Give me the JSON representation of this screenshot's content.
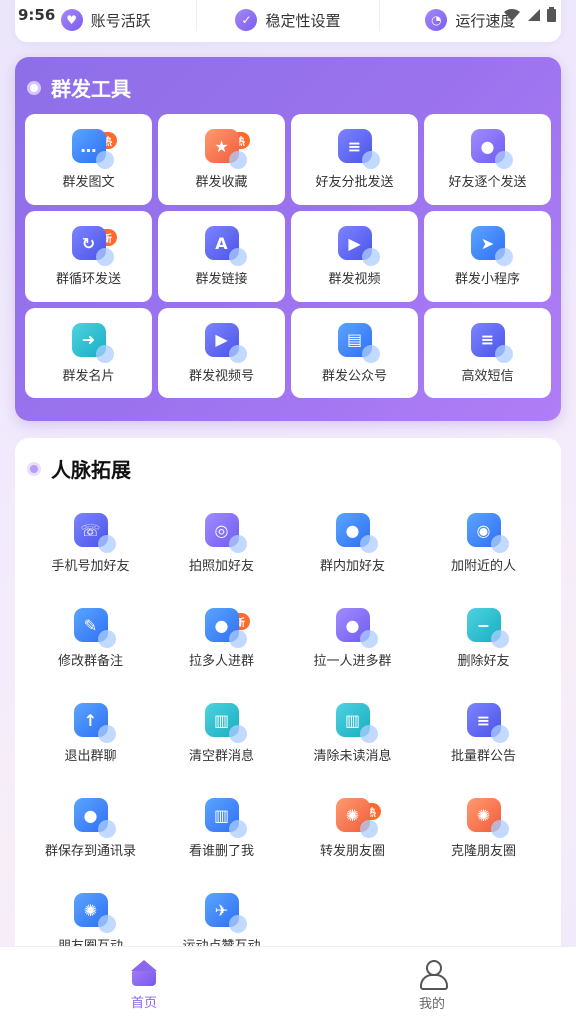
{
  "status_bar": {
    "time": "9:56"
  },
  "top_strip": {
    "items": [
      {
        "label": "账号活跃",
        "icon": "account-activity-icon"
      },
      {
        "label": "稳定性设置",
        "icon": "shield-check-icon"
      },
      {
        "label": "运行速度",
        "icon": "speedometer-icon"
      }
    ]
  },
  "tools": {
    "title": "群发工具",
    "items": [
      {
        "label": "群发图文",
        "badge": "热",
        "icon": "chat-bubble-icon"
      },
      {
        "label": "群发收藏",
        "badge": "热",
        "icon": "star-folder-icon"
      },
      {
        "label": "好友分批发送",
        "badge": "",
        "icon": "batch-list-icon"
      },
      {
        "label": "好友逐个发送",
        "badge": "",
        "icon": "contacts-icon"
      },
      {
        "label": "群循环发送",
        "badge": "新",
        "icon": "loop-send-icon"
      },
      {
        "label": "群发链接",
        "badge": "",
        "icon": "link-icon"
      },
      {
        "label": "群发视频",
        "badge": "",
        "icon": "video-icon"
      },
      {
        "label": "群发小程序",
        "badge": "",
        "icon": "paper-plane-icon"
      },
      {
        "label": "群发名片",
        "badge": "",
        "icon": "card-icon"
      },
      {
        "label": "群发视频号",
        "badge": "",
        "icon": "tv-icon"
      },
      {
        "label": "群发公众号",
        "badge": "",
        "icon": "official-account-icon"
      },
      {
        "label": "高效短信",
        "badge": "",
        "icon": "sms-icon"
      }
    ]
  },
  "network": {
    "title": "人脉拓展",
    "items": [
      {
        "label": "手机号加好友",
        "badge": "",
        "icon": "phone-add-icon"
      },
      {
        "label": "拍照加好友",
        "badge": "",
        "icon": "camera-add-icon"
      },
      {
        "label": "群内加好友",
        "badge": "",
        "icon": "group-add-icon"
      },
      {
        "label": "加附近的人",
        "badge": "",
        "icon": "location-add-icon"
      },
      {
        "label": "修改群备注",
        "badge": "",
        "icon": "edit-note-icon"
      },
      {
        "label": "拉多人进群",
        "badge": "新",
        "icon": "multi-invite-icon"
      },
      {
        "label": "拉一人进多群",
        "badge": "",
        "icon": "single-invite-icon"
      },
      {
        "label": "删除好友",
        "badge": "",
        "icon": "trash-icon"
      },
      {
        "label": "退出群聊",
        "badge": "",
        "icon": "exit-group-icon"
      },
      {
        "label": "清空群消息",
        "badge": "",
        "icon": "clear-bin-icon"
      },
      {
        "label": "清除未读消息",
        "badge": "",
        "icon": "clear-unread-icon"
      },
      {
        "label": "批量群公告",
        "badge": "",
        "icon": "announcement-icon"
      },
      {
        "label": "群保存到通讯录",
        "badge": "",
        "icon": "save-contacts-icon"
      },
      {
        "label": "看谁删了我",
        "badge": "",
        "icon": "detect-deleted-icon"
      },
      {
        "label": "转发朋友圈",
        "badge": "热",
        "icon": "moments-forward-icon"
      },
      {
        "label": "克隆朋友圈",
        "badge": "",
        "icon": "moments-clone-icon"
      },
      {
        "label": "朋友圈互动",
        "badge": "",
        "icon": "moments-interact-icon"
      },
      {
        "label": "运动点赞互动",
        "badge": "",
        "icon": "sport-like-icon"
      }
    ]
  },
  "bottom_nav": {
    "items": [
      {
        "label": "首页",
        "active": true,
        "icon": "home-icon"
      },
      {
        "label": "我的",
        "active": false,
        "icon": "user-icon"
      }
    ]
  },
  "colors": {
    "accent": "#8d66ee",
    "badge": "#ff6a2c",
    "card_gradient_start": "#8e6fe8",
    "card_gradient_end": "#b07ef6"
  }
}
